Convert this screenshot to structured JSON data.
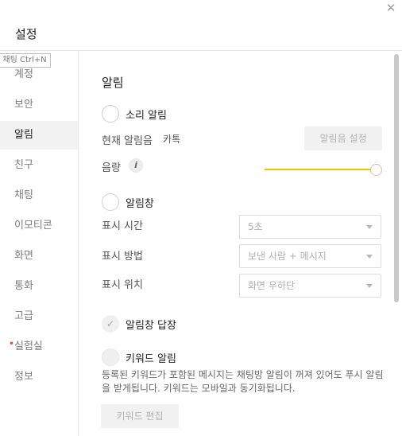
{
  "window": {
    "title": "설정",
    "close_icon": "close-icon"
  },
  "tooltip": "운 채팅 Ctrl+N",
  "sidebar": {
    "items": [
      {
        "label": "계정"
      },
      {
        "label": "보안"
      },
      {
        "label": "알림",
        "active": true
      },
      {
        "label": "친구"
      },
      {
        "label": "채팅"
      },
      {
        "label": "이모티콘"
      },
      {
        "label": "화면"
      },
      {
        "label": "통화"
      },
      {
        "label": "고급"
      },
      {
        "label": "실험실",
        "badge": "•"
      },
      {
        "label": "정보"
      }
    ]
  },
  "main": {
    "section_title": "알림",
    "sound_alert_label": "소리 알림",
    "current_sound_label": "현재 알림음",
    "current_sound_value": "카톡",
    "sound_settings_button": "알림음 설정",
    "volume_label": "음량",
    "volume_info_icon": "i",
    "volume_level": 1.0,
    "alert_window_label": "알림창",
    "display_time_label": "표시 시간",
    "display_time_value": "5초",
    "display_method_label": "표시 방법",
    "display_method_value": "보낸 사람 + 메시지",
    "display_position_label": "표시 위치",
    "display_position_value": "화면 우하단",
    "reply_label": "알림창 답장",
    "keyword_alert_label": "키워드 알림",
    "keyword_desc": "등록된 키워드가 포함된 메시지는 채팅방 알림이 꺼져 있어도 푸시 알림을 받게됩니다. 키워드는 모바일과 동기화됩니다.",
    "keyword_edit_button": "키워드 편집"
  },
  "colors": {
    "accent": "#f7c200",
    "active_bg": "#f2f2f2",
    "badge": "#e8473e"
  }
}
